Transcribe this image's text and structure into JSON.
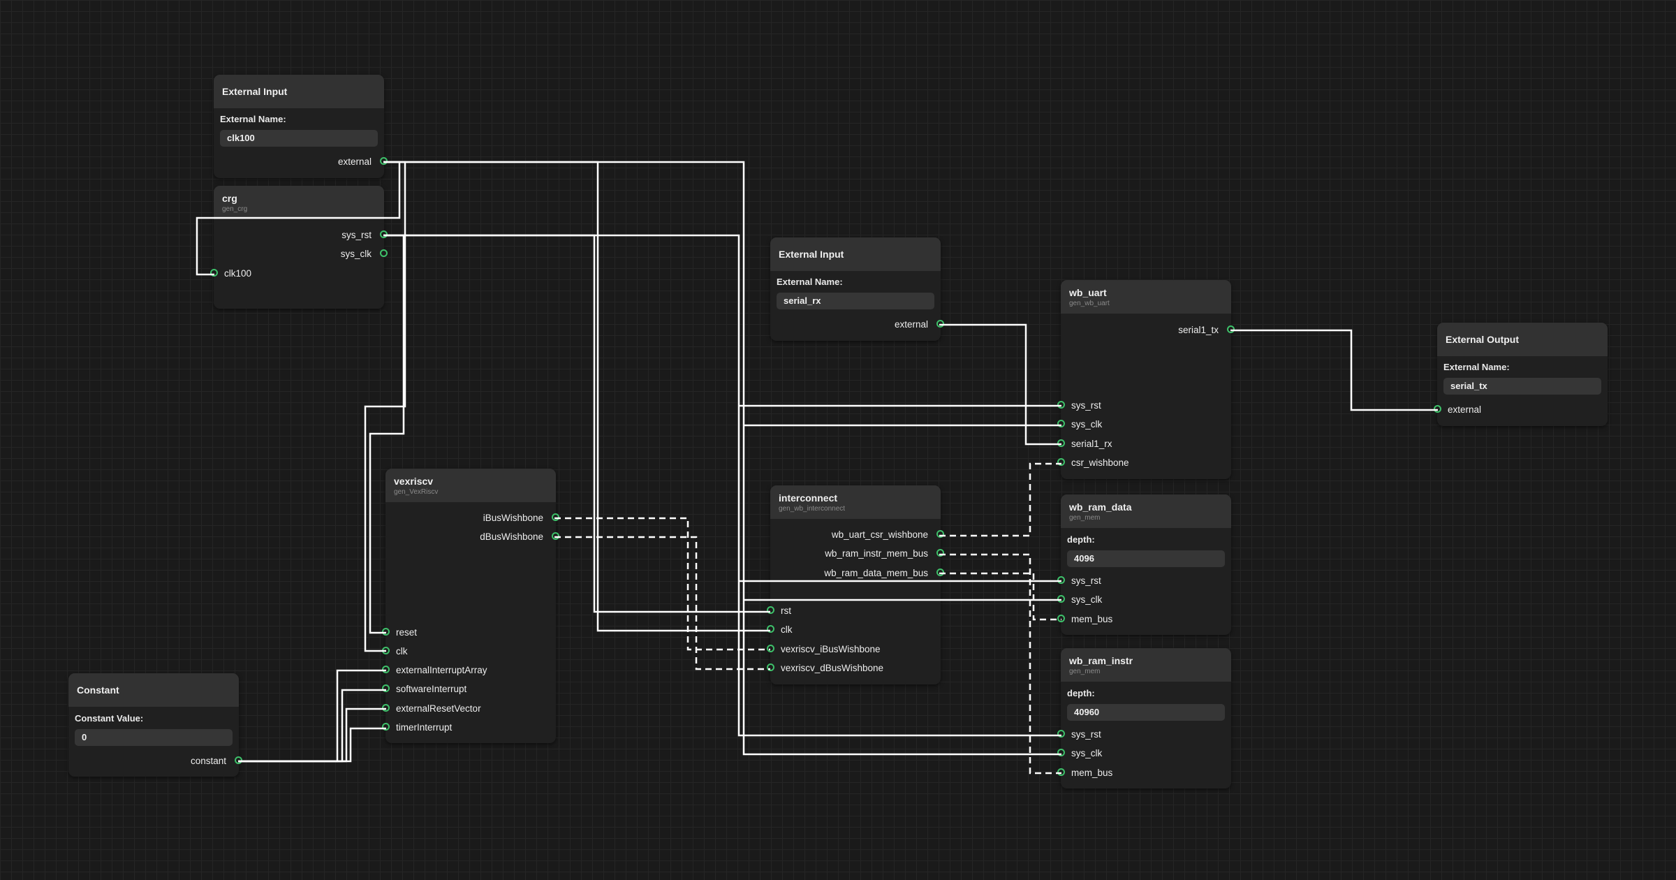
{
  "nodes": {
    "ext_clk": {
      "title": "External Input",
      "field_label": "External Name:",
      "field_value": "clk100",
      "out_ports": [
        "external"
      ]
    },
    "crg": {
      "title": "crg",
      "subtitle": "gen_crg",
      "out_ports": [
        "sys_rst",
        "sys_clk"
      ],
      "in_ports": [
        "clk100"
      ]
    },
    "ext_rx": {
      "title": "External Input",
      "field_label": "External Name:",
      "field_value": "serial_rx",
      "out_ports": [
        "external"
      ]
    },
    "wb_uart": {
      "title": "wb_uart",
      "subtitle": "gen_wb_uart",
      "out_ports": [
        "serial1_tx"
      ],
      "in_ports": [
        "sys_rst",
        "sys_clk",
        "serial1_rx",
        "csr_wishbone"
      ]
    },
    "ext_tx": {
      "title": "External Output",
      "field_label": "External Name:",
      "field_value": "serial_tx",
      "in_ports": [
        "external"
      ]
    },
    "vex": {
      "title": "vexriscv",
      "subtitle": "gen_VexRiscv",
      "out_ports": [
        "iBusWishbone",
        "dBusWishbone"
      ],
      "in_ports": [
        "reset",
        "clk",
        "externalInterruptArray",
        "softwareInterrupt",
        "externalResetVector",
        "timerInterrupt"
      ]
    },
    "inter": {
      "title": "interconnect",
      "subtitle": "gen_wb_interconnect",
      "out_ports": [
        "wb_uart_csr_wishbone",
        "wb_ram_instr_mem_bus",
        "wb_ram_data_mem_bus"
      ],
      "in_ports": [
        "rst",
        "clk",
        "vexriscv_iBusWishbone",
        "vexriscv_dBusWishbone"
      ]
    },
    "ram_data": {
      "title": "wb_ram_data",
      "subtitle": "gen_mem",
      "field_label": "depth:",
      "field_value": "4096",
      "in_ports": [
        "sys_rst",
        "sys_clk",
        "mem_bus"
      ]
    },
    "ram_instr": {
      "title": "wb_ram_instr",
      "subtitle": "gen_mem",
      "field_label": "depth:",
      "field_value": "40960",
      "in_ports": [
        "sys_rst",
        "sys_clk",
        "mem_bus"
      ]
    },
    "const": {
      "title": "Constant",
      "field_label": "Constant Value:",
      "field_value": "0",
      "out_ports": [
        "constant"
      ]
    }
  },
  "colors": {
    "background": "#1a1a1a",
    "node": "#202020",
    "node_header": "#323232",
    "port": "#3ec16a",
    "wire": "#ffffff"
  }
}
